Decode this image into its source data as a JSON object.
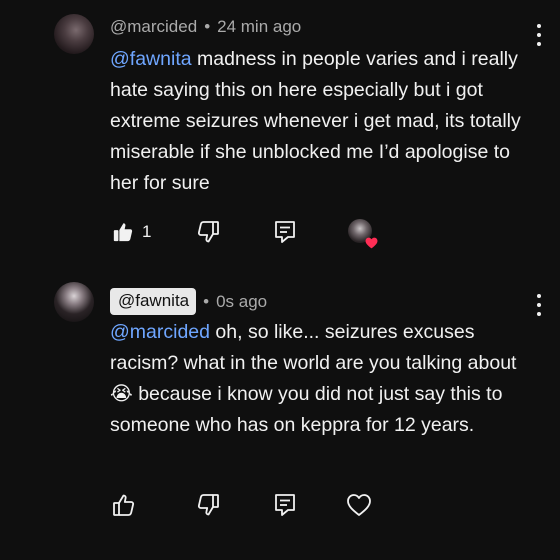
{
  "comments": [
    {
      "author": "@marcided",
      "time": "24 min ago",
      "mention": "@fawnita",
      "body": " madness in people varies and i really hate saying this on here especially but i got extreme seizures whenever i get mad, its totally miserable if she unblocked me I’d apologise to her for sure",
      "like_count": "1"
    },
    {
      "author": "@fawnita",
      "time": "0s ago",
      "mention": "@marcided",
      "body_before_emoji": " oh, so like... seizures excuses racism? what in the world are you talking about ",
      "emoji": "😭",
      "body_after_emoji": " because i know you did not just say this to someone who has on keppra for 12 years."
    }
  ],
  "icons": {
    "like": "thumbs-up-icon",
    "dislike": "thumbs-down-icon",
    "reply": "reply-icon",
    "heart": "heart-icon",
    "more": "more-vertical-icon"
  },
  "colors": {
    "background": "#0f0f0f",
    "text": "#f1f1f1",
    "meta": "#aaaaaa",
    "mention": "#6fa6ff",
    "heart": "#ff2d55"
  }
}
